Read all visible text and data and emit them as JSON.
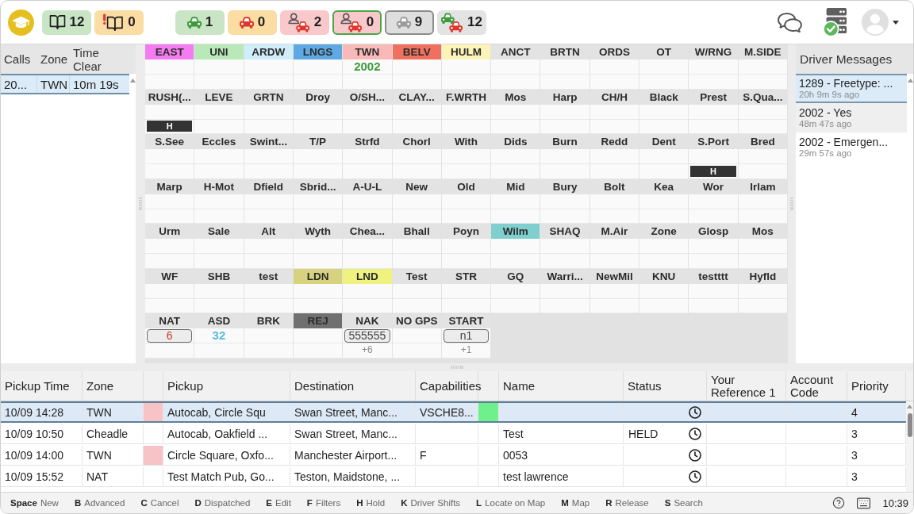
{
  "top_bar": {
    "job_counters": [
      {
        "icon": {
          "kind": "book"
        },
        "count": "12",
        "color": "#c9e5c5",
        "selected": false
      },
      {
        "icon": {
          "kind": "book-alert"
        },
        "count": "0",
        "color": "#fbdca3",
        "selected": false
      }
    ],
    "vehicle_counters": [
      {
        "icon": {
          "kind": "car",
          "color": "#3f9a3f"
        },
        "count": "1",
        "color": "#c9e5c5",
        "selected": false,
        "outlined": false
      },
      {
        "icon": {
          "kind": "car",
          "color": "#e0372c"
        },
        "count": "0",
        "color": "#fbdca3",
        "selected": false,
        "outlined": false
      },
      {
        "icon": {
          "kind": "driver-car",
          "color": "#e0372c"
        },
        "count": "2",
        "color": "#f9c8cb",
        "selected": false,
        "outlined": false
      },
      {
        "icon": {
          "kind": "driver-car",
          "color": "#e0372c"
        },
        "count": "0",
        "color": "#f9c8cb",
        "selected": true,
        "outlined": false
      },
      {
        "icon": {
          "kind": "car",
          "color": "#9a9a9a"
        },
        "count": "9",
        "color": "#dedede",
        "selected": false,
        "outlined": true
      },
      {
        "icon": {
          "kind": "car-pair",
          "color": "#e0372c"
        },
        "count": "12",
        "color": "#e3e3e3",
        "selected": false,
        "outlined": false
      }
    ]
  },
  "calls_panel": {
    "columns": [
      "Calls",
      "Zone",
      "Time Clear"
    ],
    "rows": [
      {
        "cells": [
          "20...",
          "TWN",
          "10m 19s"
        ],
        "selected": true
      }
    ]
  },
  "zone_grid": {
    "zones": [
      {
        "name": "EAST",
        "color": "#f47cf0"
      },
      {
        "name": "UNI",
        "color": "#b9e9b9"
      },
      {
        "name": "ARDW",
        "color": "#d0eef9"
      },
      {
        "name": "LNGS",
        "color": "#5ea8e4"
      },
      {
        "name": "TWN",
        "color": "#f9b9b9",
        "row_1": {
          "kind": "plain",
          "text": "2002",
          "color": "#3d9a3d"
        }
      },
      {
        "name": "BELV",
        "color": "#ef705f"
      },
      {
        "name": "HULM",
        "color": "#fbf3b8"
      },
      {
        "name": "ANCT"
      },
      {
        "name": "BRTN"
      },
      {
        "name": "ORDS"
      },
      {
        "name": "OT"
      },
      {
        "name": "W/RNG"
      },
      {
        "name": "M.SIDE"
      },
      {
        "name": "RUSH(...",
        "row_2": {
          "kind": "badge",
          "text": "H"
        }
      },
      {
        "name": "LEVE"
      },
      {
        "name": "GRTN"
      },
      {
        "name": "Droy"
      },
      {
        "name": "O/SH..."
      },
      {
        "name": "CLAY..."
      },
      {
        "name": "F.WRTH"
      },
      {
        "name": "Mos"
      },
      {
        "name": "Harp"
      },
      {
        "name": "CH/H"
      },
      {
        "name": "Black"
      },
      {
        "name": "Prest"
      },
      {
        "name": "S.Qua..."
      },
      {
        "name": "S.See"
      },
      {
        "name": "Eccles"
      },
      {
        "name": "Swint..."
      },
      {
        "name": "T/P"
      },
      {
        "name": "Strfd"
      },
      {
        "name": "Chorl"
      },
      {
        "name": "With"
      },
      {
        "name": "Dids"
      },
      {
        "name": "Burn"
      },
      {
        "name": "Redd"
      },
      {
        "name": "Dent"
      },
      {
        "name": "S.Port",
        "row_2": {
          "kind": "badge",
          "text": "H"
        }
      },
      {
        "name": "Bred"
      },
      {
        "name": "Marp"
      },
      {
        "name": "H-Mot"
      },
      {
        "name": "Dfield"
      },
      {
        "name": "Sbrid..."
      },
      {
        "name": "A-U-L"
      },
      {
        "name": "New"
      },
      {
        "name": "Old"
      },
      {
        "name": "Mid"
      },
      {
        "name": "Bury"
      },
      {
        "name": "Bolt"
      },
      {
        "name": "Kea"
      },
      {
        "name": "Wor"
      },
      {
        "name": "Irlam"
      },
      {
        "name": "Urm"
      },
      {
        "name": "Sale"
      },
      {
        "name": "Alt"
      },
      {
        "name": "Wyth"
      },
      {
        "name": "Chea..."
      },
      {
        "name": "Bhall"
      },
      {
        "name": "Poyn"
      },
      {
        "name": "Wilm",
        "color": "#7fcfcf"
      },
      {
        "name": "SHAQ"
      },
      {
        "name": "M.Air"
      },
      {
        "name": "Zone"
      },
      {
        "name": "Glosp"
      },
      {
        "name": "Mos"
      },
      {
        "name": "WF"
      },
      {
        "name": "SHB"
      },
      {
        "name": "test"
      },
      {
        "name": "LDN",
        "color": "#d6d27e"
      },
      {
        "name": "LND",
        "color": "#eff27e"
      },
      {
        "name": "Test"
      },
      {
        "name": "STR"
      },
      {
        "name": "GQ"
      },
      {
        "name": "Warri..."
      },
      {
        "name": "NewMil"
      },
      {
        "name": "KNU"
      },
      {
        "name": "testttt"
      },
      {
        "name": "Hyfld"
      },
      {
        "name": "NAT",
        "row_1": {
          "kind": "boxed",
          "text": "6",
          "color": "#c0392b"
        }
      },
      {
        "name": "ASD",
        "row_1": {
          "kind": "plain",
          "text": "32",
          "color": "#5cb8dc"
        }
      },
      {
        "name": "BRK"
      },
      {
        "name": "REJ",
        "color": "#707070"
      },
      {
        "name": "NAK",
        "row_1": {
          "kind": "boxed",
          "text": "555555",
          "color": "#444444"
        },
        "row_2": {
          "kind": "note",
          "text": "+6",
          "color": "#8a8a8a"
        }
      },
      {
        "name": "NO GPS"
      },
      {
        "name": "START",
        "row_1": {
          "kind": "boxed",
          "text": "n1",
          "color": "#444444"
        },
        "row_2": {
          "kind": "note",
          "text": "+1",
          "color": "#8a8a8a"
        }
      }
    ]
  },
  "driver_messages": {
    "title": "Driver Messages",
    "messages": [
      {
        "text": "1289 - Freetype: ...",
        "time": "20h 9m 9s ago",
        "selected": true
      },
      {
        "text": "2002 - Yes",
        "time": "48m 47s ago",
        "selected": false
      },
      {
        "text": "2002 - Emergen...",
        "time": "29m 57s ago",
        "selected": false
      }
    ]
  },
  "jobs_table": {
    "columns": [
      "Pickup Time",
      "Zone",
      "Pickup",
      "Destination",
      "Capabilities",
      "Name",
      "Status",
      "Your Reference 1",
      "Account Code",
      "Priority"
    ],
    "rows": [
      {
        "pickup_time": "10/09 14:28",
        "zone": "TWN",
        "zone_swatch": {
          "color": "#f7c3c6"
        },
        "pickup": "Autocab, Circle Squ",
        "destination": "Swan Street, Manc...",
        "capabilities": "VSCHE8...",
        "capability_swatch": {
          "color": "#6ef08c"
        },
        "priority": "4",
        "selected": true
      },
      {
        "pickup_time": "10/09 10:50",
        "zone": "Cheadle",
        "pickup": "Autocab, Oakfield ...",
        "destination": "Swan Street, Manc...",
        "name": "Test",
        "status": "HELD",
        "priority": "3",
        "selected": false
      },
      {
        "pickup_time": "10/09 14:00",
        "zone": "TWN",
        "zone_swatch": {
          "color": "#f7c3c6"
        },
        "pickup": "Circle Square, Oxfo...",
        "destination": "Manchester Airport...",
        "capabilities": "F",
        "name": "0053",
        "priority": "3",
        "selected": false
      },
      {
        "pickup_time": "10/09 15:52",
        "zone": "NAT",
        "pickup": "Test Match Pub, Go...",
        "destination": "Teston, Maidstone, ...",
        "name": "test lawrence",
        "priority": "3",
        "selected": false
      }
    ]
  },
  "status_bar": {
    "shortcuts": [
      {
        "key": "Space",
        "label": "New"
      },
      {
        "key": "B",
        "label": "Advanced"
      },
      {
        "key": "C",
        "label": "Cancel"
      },
      {
        "key": "D",
        "label": "Dispatched"
      },
      {
        "key": "E",
        "label": "Edit"
      },
      {
        "key": "F",
        "label": "Filters"
      },
      {
        "key": "H",
        "label": "Hold"
      },
      {
        "key": "K",
        "label": "Driver Shifts"
      },
      {
        "key": "L",
        "label": "Locate on Map"
      },
      {
        "key": "M",
        "label": "Map"
      },
      {
        "key": "R",
        "label": "Release"
      },
      {
        "key": "S",
        "label": "Search"
      }
    ],
    "time": "10:39"
  }
}
